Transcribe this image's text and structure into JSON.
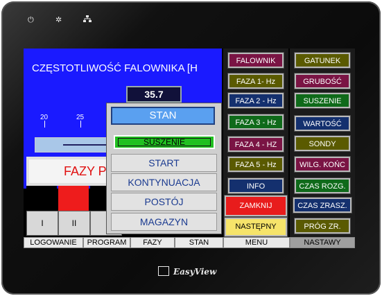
{
  "device": {
    "top_icons": [
      "power-icon",
      "brightness-icon",
      "network-icon"
    ],
    "brand": "EasyView"
  },
  "main": {
    "title": "CZĘSTOTLIWOŚĆ FALOWNIKA [H",
    "frequency_value": "35.7",
    "scale_ticks": [
      "20",
      "25"
    ],
    "fazy_title": "FAZY P"
  },
  "phase_indicators": [
    {
      "color": "#000000"
    },
    {
      "color": "#ee1c1c"
    },
    {
      "color": "#000000"
    }
  ],
  "phase_buttons": [
    "I",
    "II",
    ""
  ],
  "bottom_tabs": [
    "LOGOWANIE",
    "PROGRAM",
    "FAZY",
    "STAN",
    "MENU",
    "NASTAWY"
  ],
  "menu_col1": [
    {
      "label": "FALOWNIK",
      "bg": "#7a1444",
      "fg": "#ffffff"
    },
    {
      "label": "FAZA 1- Hz",
      "bg": "#5a5a00",
      "fg": "#ffffff"
    },
    {
      "label": "FAZA 2 - Hz",
      "bg": "#14306e",
      "fg": "#ffffff"
    },
    {
      "label": "FAZA 3 - Hz",
      "bg": "#0f6a1a",
      "fg": "#ffffff"
    },
    {
      "label": "FAZA 4 - HZ",
      "bg": "#7a1444",
      "fg": "#ffffff"
    },
    {
      "label": "FAZA 5 - Hz",
      "bg": "#5a5a00",
      "fg": "#ffffff"
    },
    {
      "label": "INFO",
      "bg": "#14306e",
      "fg": "#ffffff"
    },
    {
      "label": "ZAMKNIJ",
      "bg": "#e81c1c",
      "fg": "#ffffff"
    },
    {
      "label": "NASTĘPNY",
      "bg": "#f6e46a",
      "fg": "#000000"
    }
  ],
  "menu_col2": [
    {
      "label": "GATUNEK",
      "bg": "#5a5a00",
      "fg": "#ffffff"
    },
    {
      "label": "GRUBOŚĆ",
      "bg": "#7a1444",
      "fg": "#ffffff"
    },
    {
      "label": "SUSZENIE",
      "bg": "#0f6a1a",
      "fg": "#ffffff"
    },
    {
      "label": "WARTOŚĆ",
      "bg": "#14306e",
      "fg": "#ffffff"
    },
    {
      "label": "SONDY",
      "bg": "#5a5a00",
      "fg": "#ffffff"
    },
    {
      "label": "WILG. KOŃC",
      "bg": "#7a1444",
      "fg": "#ffffff"
    },
    {
      "label": "CZAS ROZG.",
      "bg": "#0f6a1a",
      "fg": "#ffffff"
    },
    {
      "label": "CZAS ZRASZ.",
      "bg": "#14306e",
      "fg": "#ffffff"
    },
    {
      "label": "PRÓG ZR.",
      "bg": "#5a5a00",
      "fg": "#ffffff"
    }
  ],
  "popup": {
    "title": "STAN",
    "status": "SUSZENIE",
    "items": [
      "START",
      "KONTYNUACJA",
      "POSTÓJ",
      "MAGAZYN"
    ]
  }
}
